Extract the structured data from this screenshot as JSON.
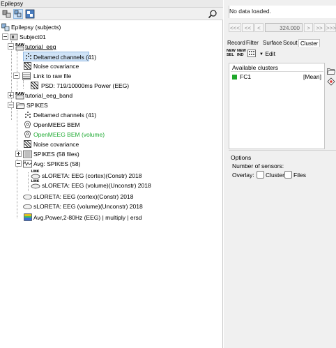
{
  "left_panel": {
    "title": "Epilepsy",
    "tree": {
      "root_label": "Epilepsy (subjects)",
      "subject_label": "Subject01",
      "tutorial_eeg_label": "tutorial_eeg",
      "deltamed_label": "Deltamed channels (41)",
      "noise_cov_label": "Noise covariance",
      "link_raw_label": "Link to raw file",
      "psd_label": "PSD: 719/10000ms Power (EEG)",
      "tutorial_eeg_band_label": "tutorial_eeg_band",
      "spikes_label": "SPIKES",
      "spikes_deltamed_label": "Deltamed channels (41)",
      "openmeeg_label": "OpenMEEG BEM",
      "openmeeg_vol_label": "OpenMEEG BEM (volume)",
      "spikes_noise_label": "Noise covariance",
      "spikes_files_label": "SPIKES (58 files)",
      "avg_spikes_label": "Avg: SPIKES (58)",
      "sloreta_link1_label": "sLORETA: EEG (cortex)(Constr) 2018",
      "sloreta_link2_label": "sLORETA: EEG (volume)(Unconstr) 2018",
      "sloreta1_label": "sLORETA: EEG (cortex)(Constr) 2018",
      "sloreta2_label": "sLORETA: EEG (volume)(Unconstr) 2018",
      "avg_power_label": "Avg.Power,2-80Hz (EEG) | multiply | ersd"
    }
  },
  "right_panel": {
    "status_text": "No data loaded.",
    "nav": {
      "first": "<<<",
      "prev_big": "<<",
      "prev": "<",
      "time_value": "324.000",
      "next": ">",
      "next_big": ">>",
      "last": ">>>"
    },
    "tabs": [
      "Record",
      "Filter",
      "Surface",
      "Scout",
      "Cluster"
    ],
    "active_tab": "Cluster",
    "cluster_toolbar": {
      "new_sel_top": "NEW",
      "new_sel_bottom": "SEL",
      "new_ind_top": "NEW",
      "new_ind_bottom": "IND",
      "edit_label": "Edit"
    },
    "available_clusters_title": "Available clusters",
    "clusters": [
      {
        "name": "FC1",
        "function": "[Mean]",
        "color": "#1fa82b"
      }
    ],
    "options": {
      "title": "Options",
      "number_of_sensors_label": "Number of sensors:",
      "overlay_label": "Overlay:",
      "cluster_checkbox_label": "Cluster",
      "files_checkbox_label": "Files"
    }
  }
}
